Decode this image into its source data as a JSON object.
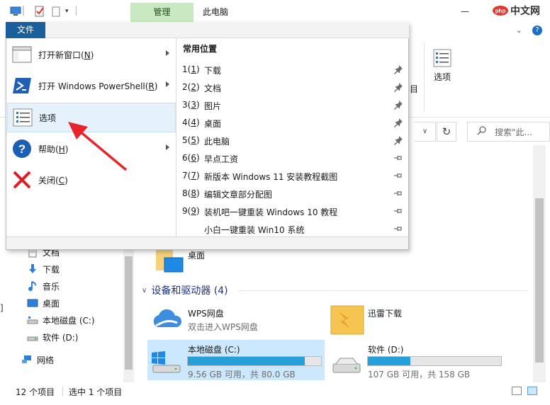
{
  "titlebar": {
    "manage_tab": "管理",
    "title": "此电脑",
    "watermark": "php中文网"
  },
  "ribbon": {
    "options_label": "选项",
    "fragment_label": "目"
  },
  "search": {
    "placeholder": "搜索\"此..."
  },
  "nav": {
    "items": [
      {
        "label": "文档",
        "icon": "documents-icon"
      },
      {
        "label": "下载",
        "icon": "download-arrow-icon"
      },
      {
        "label": "音乐",
        "icon": "music-note-icon"
      },
      {
        "label": "桌面",
        "icon": "desktop-icon"
      },
      {
        "label": "本地磁盘 (C:)",
        "icon": "drive-icon"
      },
      {
        "label": "软件 (D:)",
        "icon": "drive-icon"
      },
      {
        "label": "网络",
        "icon": "network-icon"
      }
    ]
  },
  "content": {
    "desktop_label": "桌面",
    "group_header": "设备和驱动器 (4)",
    "wps": {
      "title": "WPS网盘",
      "sub": "双击进入WPS网盘"
    },
    "xunlei": {
      "title": "迅雷下载"
    },
    "drive_c": {
      "title": "本地磁盘 (C:)",
      "sub": "9.56 GB 可用，共 80.0 GB",
      "used_fraction": 0.88
    },
    "drive_d": {
      "title": "软件 (D:)",
      "sub": "107 GB 可用，共 158 GB",
      "used_fraction": 0.32
    }
  },
  "status": {
    "count": "12 个项目",
    "selected": "选中 1 个项目"
  },
  "file_menu": {
    "tab_label": "文件",
    "items": [
      {
        "label": "打开新窗口",
        "accel": "N",
        "has_arrow": true,
        "icon": "new-window-icon"
      },
      {
        "label": "打开 Windows PowerShell",
        "accel": "R",
        "has_arrow": true,
        "icon": "powershell-icon"
      },
      {
        "label": "选项",
        "accel": "",
        "has_arrow": false,
        "icon": "options-icon"
      },
      {
        "label": "帮助",
        "accel": "H",
        "has_arrow": true,
        "icon": "help-icon"
      },
      {
        "label": "关闭",
        "accel": "C",
        "has_arrow": false,
        "icon": "close-icon"
      }
    ],
    "recent_header": "常用位置",
    "recent": [
      {
        "num": "1",
        "accel": "1",
        "name": "下载",
        "pinned": true
      },
      {
        "num": "2",
        "accel": "2",
        "name": "文档",
        "pinned": true
      },
      {
        "num": "3",
        "accel": "3",
        "name": "图片",
        "pinned": true
      },
      {
        "num": "4",
        "accel": "4",
        "name": "桌面",
        "pinned": true
      },
      {
        "num": "5",
        "accel": "5",
        "name": "此电脑",
        "pinned": true
      },
      {
        "num": "6",
        "accel": "6",
        "name": "早点工资",
        "pinned": false
      },
      {
        "num": "7",
        "accel": "7",
        "name": "新版本 Windows 11 安装教程截图",
        "pinned": false
      },
      {
        "num": "8",
        "accel": "8",
        "name": "编辑文章部分配图",
        "pinned": false
      },
      {
        "num": "9",
        "accel": "9",
        "name": "装机吧一键重装 Windows 10 教程",
        "pinned": false
      },
      {
        "num": "",
        "accel": "",
        "name": "小白一键重装 Win10 系统",
        "pinned": false
      }
    ]
  },
  "colors": {
    "file_tab": "#1a5f9c",
    "manage_tab": "#c9e9c2",
    "hover": "#e5f1fb",
    "selected_tile": "#cce8ff",
    "drive_bar": "#26a0da",
    "arrow": "#e8232a"
  }
}
